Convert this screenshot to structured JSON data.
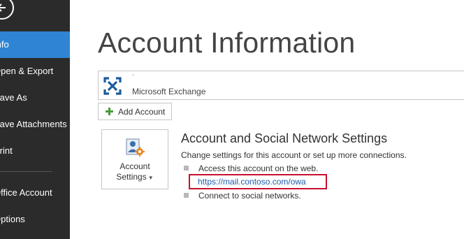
{
  "sidebar": {
    "items": [
      {
        "label": "Info",
        "active": true
      },
      {
        "label": "Open & Export"
      },
      {
        "label": "Save As"
      },
      {
        "label": "Save Attachments"
      },
      {
        "label": "Print"
      },
      {
        "label": "Office Account"
      },
      {
        "label": "Options"
      }
    ]
  },
  "main": {
    "title": "Account Information",
    "account": {
      "name": "·",
      "type": "Microsoft Exchange"
    },
    "add_account_label": "Add Account",
    "account_settings": {
      "line1": "Account",
      "line2": "Settings"
    },
    "section": {
      "title": "Account and Social Network Settings",
      "description": "Change settings for this account or set up more connections.",
      "bullets": [
        "Access this account on the web.",
        "Connect to social networks."
      ],
      "owa_link": "https://mail.contoso.com/owa"
    }
  },
  "colors": {
    "sidebar_bg": "#2b2b2b",
    "active_item": "#2f85d3",
    "highlight_border": "#c8102e",
    "link": "#1e5ea8",
    "exchange_icon": "#1a5c9e",
    "plus_icon": "#4a9c3c"
  }
}
